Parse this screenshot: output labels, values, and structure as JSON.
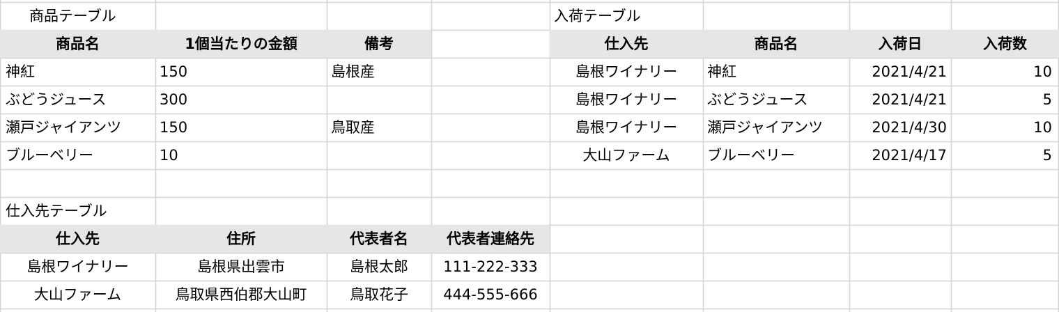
{
  "product_table": {
    "title": "商品テーブル",
    "headers": [
      "商品名",
      "1個当たりの金額",
      "備考"
    ],
    "rows": [
      [
        "神紅",
        "150",
        "島根産"
      ],
      [
        "ぶどうジュース",
        "300",
        ""
      ],
      [
        "瀬戸ジャイアンツ",
        "150",
        "鳥取産"
      ],
      [
        "ブルーベリー",
        "10",
        ""
      ]
    ]
  },
  "arrival_table": {
    "title": "入荷テーブル",
    "headers": [
      "仕入先",
      "商品名",
      "入荷日",
      "入荷数"
    ],
    "rows": [
      [
        "島根ワイナリー",
        "神紅",
        "2021/4/21",
        "10"
      ],
      [
        "島根ワイナリー",
        "ぶどうジュース",
        "2021/4/21",
        "5"
      ],
      [
        "島根ワイナリー",
        "瀬戸ジャイアンツ",
        "2021/4/30",
        "10"
      ],
      [
        "大山ファーム",
        "ブルーベリー",
        "2021/4/17",
        "5"
      ]
    ]
  },
  "supplier_table": {
    "title": "仕入先テーブル",
    "headers": [
      "仕入先",
      "住所",
      "代表者名",
      "代表者連絡先"
    ],
    "rows": [
      [
        "島根ワイナリー",
        "島根県出雲市",
        "島根太郎",
        "111-222-333"
      ],
      [
        "大山ファーム",
        "鳥取県西伯郡大山町",
        "鳥取花子",
        "444-555-666"
      ]
    ]
  },
  "colors": {
    "header_fill": "#e6e6e6",
    "gridline": "#d4d4d4",
    "text": "#000000"
  }
}
